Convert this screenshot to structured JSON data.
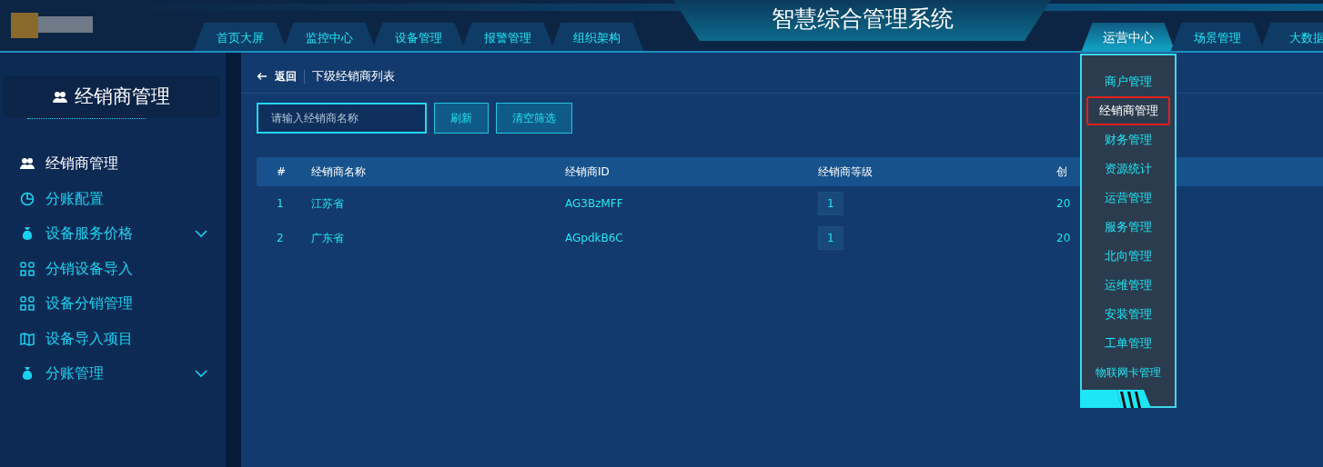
{
  "header": {
    "title": "智慧综合管理系统",
    "tabs_left": [
      {
        "label": "首页大屏",
        "selected": false
      },
      {
        "label": "监控中心",
        "selected": false
      },
      {
        "label": "设备管理",
        "selected": false
      },
      {
        "label": "报警管理",
        "selected": false
      },
      {
        "label": "组织架构",
        "selected": false
      }
    ],
    "tabs_right": [
      {
        "label": "运营中心",
        "selected": true
      },
      {
        "label": "场景管理",
        "selected": false
      },
      {
        "label": "大数据",
        "selected": false
      }
    ]
  },
  "sidebar": {
    "title": "经销商管理",
    "items": [
      {
        "label": "经销商管理",
        "kind": "link",
        "selected": true
      },
      {
        "label": "分账配置",
        "kind": "link",
        "selected": false
      },
      {
        "label": "设备服务价格",
        "kind": "group",
        "selected": false
      },
      {
        "label": "分销设备导入",
        "kind": "link",
        "selected": false
      },
      {
        "label": "设备分销管理",
        "kind": "link",
        "selected": false
      },
      {
        "label": "设备导入项目",
        "kind": "link",
        "selected": false
      },
      {
        "label": "分账管理",
        "kind": "group",
        "selected": false
      }
    ]
  },
  "main": {
    "back": "返回",
    "title": "下级经销商列表",
    "search": {
      "placeholder": "请输入经销商名称"
    },
    "buttons": [
      "刷新",
      "清空筛选"
    ],
    "table": {
      "columns": [
        "#",
        "经销商名称",
        "经销商ID",
        "经销商等级",
        "创"
      ],
      "rows": [
        [
          "1",
          "江苏省",
          "AG3BzMFF",
          "1",
          "20"
        ],
        [
          "2",
          "广东省",
          "AGpdkB6C",
          "1",
          "20"
        ]
      ]
    }
  },
  "dropdown": {
    "items": [
      {
        "label": "商户管理",
        "selected": false
      },
      {
        "label": "经销商管理",
        "selected": true
      },
      {
        "label": "财务管理",
        "selected": false
      },
      {
        "label": "资源统计",
        "selected": false
      },
      {
        "label": "运营管理",
        "selected": false
      },
      {
        "label": "服务管理",
        "selected": false
      },
      {
        "label": "北向管理",
        "selected": false
      },
      {
        "label": "运维管理",
        "selected": false
      },
      {
        "label": "安装管理",
        "selected": false
      },
      {
        "label": "工单管理",
        "selected": false
      },
      {
        "label": "物联网卡管理",
        "selected": false
      }
    ]
  }
}
